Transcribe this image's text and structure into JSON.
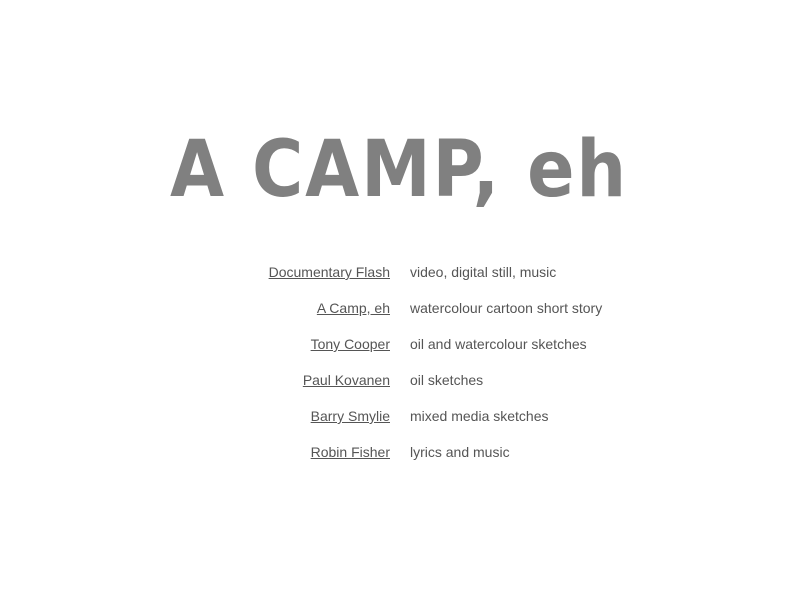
{
  "logo": {
    "text": "A CAMP, eh",
    "color": "#808080"
  },
  "links": [
    {
      "label": "Documentary Flash",
      "description": "video, digital still, music"
    },
    {
      "label": "A Camp, eh",
      "description": "watercolour cartoon short story"
    },
    {
      "label": "Tony Cooper",
      "description": "oil and watercolour sketches"
    },
    {
      "label": "Paul Kovanen",
      "description": "oil sketches"
    },
    {
      "label": "Barry Smylie",
      "description": "mixed media sketches"
    },
    {
      "label": "Robin Fisher",
      "description": "lyrics and music"
    }
  ],
  "colors": {
    "text": "#555555",
    "background": "#ffffff"
  }
}
